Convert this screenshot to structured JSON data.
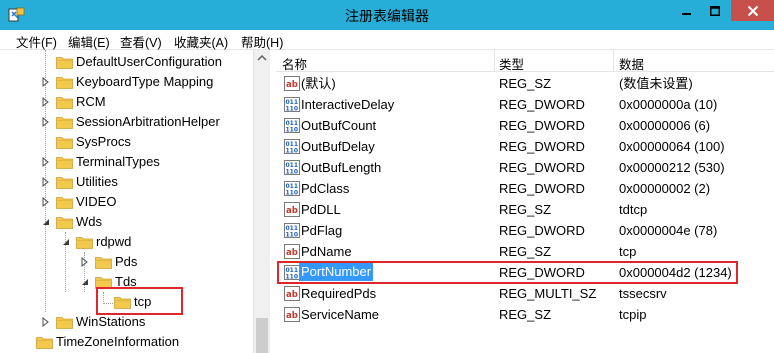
{
  "window": {
    "title": "注册表编辑器",
    "accent_color": "#27aed8",
    "close_color": "#c7504a"
  },
  "menu": [
    {
      "label": "文件(F)"
    },
    {
      "label": "编辑(E)"
    },
    {
      "label": "查看(V)"
    },
    {
      "label": "收藏夹(A)"
    },
    {
      "label": "帮助(H)"
    }
  ],
  "tree": {
    "items": [
      {
        "label": "DefaultUserConfiguration",
        "expander": "none"
      },
      {
        "label": "KeyboardType Mapping",
        "expander": "collapsed"
      },
      {
        "label": "RCM",
        "expander": "collapsed"
      },
      {
        "label": "SessionArbitrationHelper",
        "expander": "collapsed"
      },
      {
        "label": "SysProcs",
        "expander": "none"
      },
      {
        "label": "TerminalTypes",
        "expander": "collapsed"
      },
      {
        "label": "Utilities",
        "expander": "collapsed"
      },
      {
        "label": "VIDEO",
        "expander": "collapsed"
      },
      {
        "label": "Wds",
        "expander": "expanded"
      },
      {
        "label": "rdpwd",
        "expander": "expanded"
      },
      {
        "label": "Pds",
        "expander": "collapsed"
      },
      {
        "label": "Tds",
        "expander": "expanded"
      },
      {
        "label": "tcp",
        "expander": "none",
        "highlighted": true
      },
      {
        "label": "WinStations",
        "expander": "collapsed"
      },
      {
        "label": "TimeZoneInformation",
        "expander": "none"
      }
    ]
  },
  "list": {
    "columns": [
      "名称",
      "类型",
      "数据"
    ],
    "rows": [
      {
        "icon": "string-value-icon",
        "name": "(默认)",
        "type": "REG_SZ",
        "data": "(数值未设置)"
      },
      {
        "icon": "binary-value-icon",
        "name": "InteractiveDelay",
        "type": "REG_DWORD",
        "data": "0x0000000a (10)"
      },
      {
        "icon": "binary-value-icon",
        "name": "OutBufCount",
        "type": "REG_DWORD",
        "data": "0x00000006 (6)"
      },
      {
        "icon": "binary-value-icon",
        "name": "OutBufDelay",
        "type": "REG_DWORD",
        "data": "0x00000064 (100)"
      },
      {
        "icon": "binary-value-icon",
        "name": "OutBufLength",
        "type": "REG_DWORD",
        "data": "0x00000212 (530)"
      },
      {
        "icon": "binary-value-icon",
        "name": "PdClass",
        "type": "REG_DWORD",
        "data": "0x00000002 (2)"
      },
      {
        "icon": "string-value-icon",
        "name": "PdDLL",
        "type": "REG_SZ",
        "data": "tdtcp"
      },
      {
        "icon": "binary-value-icon",
        "name": "PdFlag",
        "type": "REG_DWORD",
        "data": "0x0000004e (78)"
      },
      {
        "icon": "string-value-icon",
        "name": "PdName",
        "type": "REG_SZ",
        "data": "tcp"
      },
      {
        "icon": "binary-value-icon",
        "name": "PortNumber",
        "type": "REG_DWORD",
        "data": "0x000004d2 (1234)",
        "selected": true
      },
      {
        "icon": "string-value-icon",
        "name": "RequiredPds",
        "type": "REG_MULTI_SZ",
        "data": "tssecsrv"
      },
      {
        "icon": "string-value-icon",
        "name": "ServiceName",
        "type": "REG_SZ",
        "data": "tcpip"
      }
    ]
  },
  "highlight_color": "#e0262b",
  "selection_color": "#3399ff"
}
